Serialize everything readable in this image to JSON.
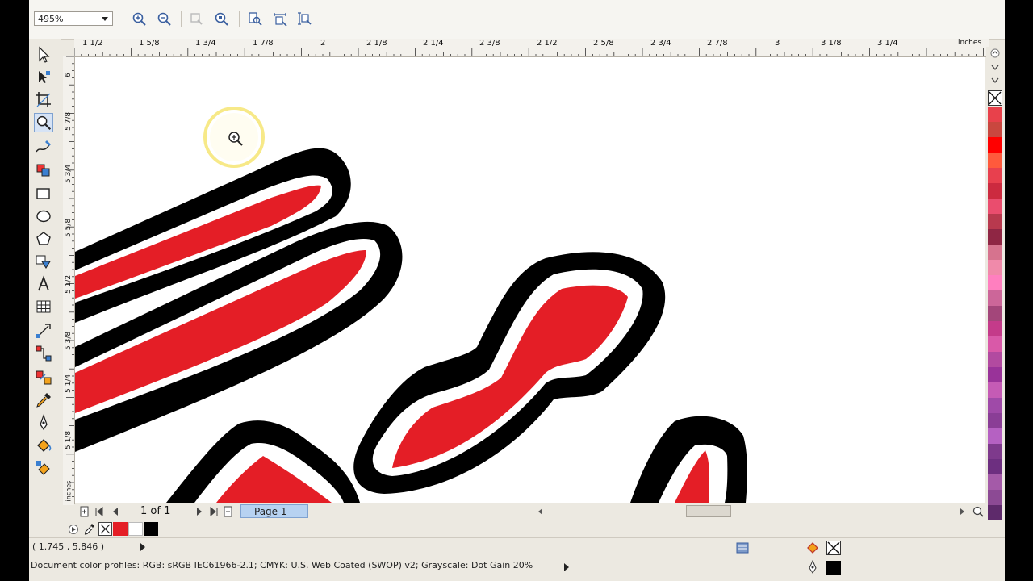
{
  "toolbar": {
    "zoom_value": "495%",
    "buttons": [
      "zoom-in-icon",
      "zoom-out-icon",
      "zoom-to-selected-icon",
      "zoom-to-all-objects-icon",
      "zoom-to-page-icon",
      "zoom-to-page-width-icon",
      "zoom-to-page-height-icon"
    ]
  },
  "rulers": {
    "horizontal_labels": [
      "1 1/2",
      "1 5/8",
      "1 3/4",
      "1 7/8",
      "2",
      "2 1/8",
      "2 1/4",
      "2 3/8",
      "2 1/2",
      "2 5/8",
      "2 3/4",
      "2 7/8",
      "3",
      "3 1/8",
      "3 1/4"
    ],
    "units": "inches",
    "vertical_labels": [
      "6",
      "5 7/8",
      "5 3/4",
      "5 5/8",
      "5 1/2",
      "5 3/8",
      "5 1/4",
      "5 1/8"
    ],
    "vertical_units": "inches"
  },
  "tools": [
    "pick-tool-icon",
    "shape-tool-icon",
    "crop-tool-icon",
    "zoom-tool-icon",
    "freehand-tool-icon",
    "smart-fill-icon",
    "rectangle-tool-icon",
    "ellipse-tool-icon",
    "polygon-tool-icon",
    "basic-shapes-icon",
    "text-tool-icon",
    "table-tool-icon",
    "dimension-tool-icon",
    "connector-tool-icon",
    "interactive-blend-icon",
    "eyedropper-tool-icon",
    "outline-tool-icon",
    "fill-tool-icon",
    "interactive-fill-icon"
  ],
  "navigation": {
    "page_count": "1 of 1",
    "page_tab": "Page 1"
  },
  "status": {
    "coordinates": "( 1.745 , 5.846 )",
    "color_profiles": "Document color profiles: RGB: sRGB IEC61966-2.1; CMYK: U.S. Web Coated (SWOP) v2; Grayscale: Dot Gain 20%"
  },
  "colors": {
    "red": "#e41e26",
    "black": "#000000",
    "white": "#ffffff",
    "cursor_ring": "#f5e36a"
  },
  "palette_swatches": [
    "#e8414b",
    "#c9473f",
    "#ff0000",
    "#ff5a3c",
    "#e8404e",
    "#cc2a3f",
    "#ea4d6e",
    "#b8394e",
    "#8f2644",
    "#d6738e",
    "#f08aaa",
    "#ff7fbf",
    "#cc6699",
    "#a3467a",
    "#c43b8a",
    "#d959a8",
    "#b24aa0",
    "#993399",
    "#c55bb5",
    "#9f4aa8",
    "#8a3e96",
    "#b561c2",
    "#7e3a8c",
    "#6d2f80",
    "#a45aa8",
    "#8c4a94",
    "#5e2a6b"
  ]
}
